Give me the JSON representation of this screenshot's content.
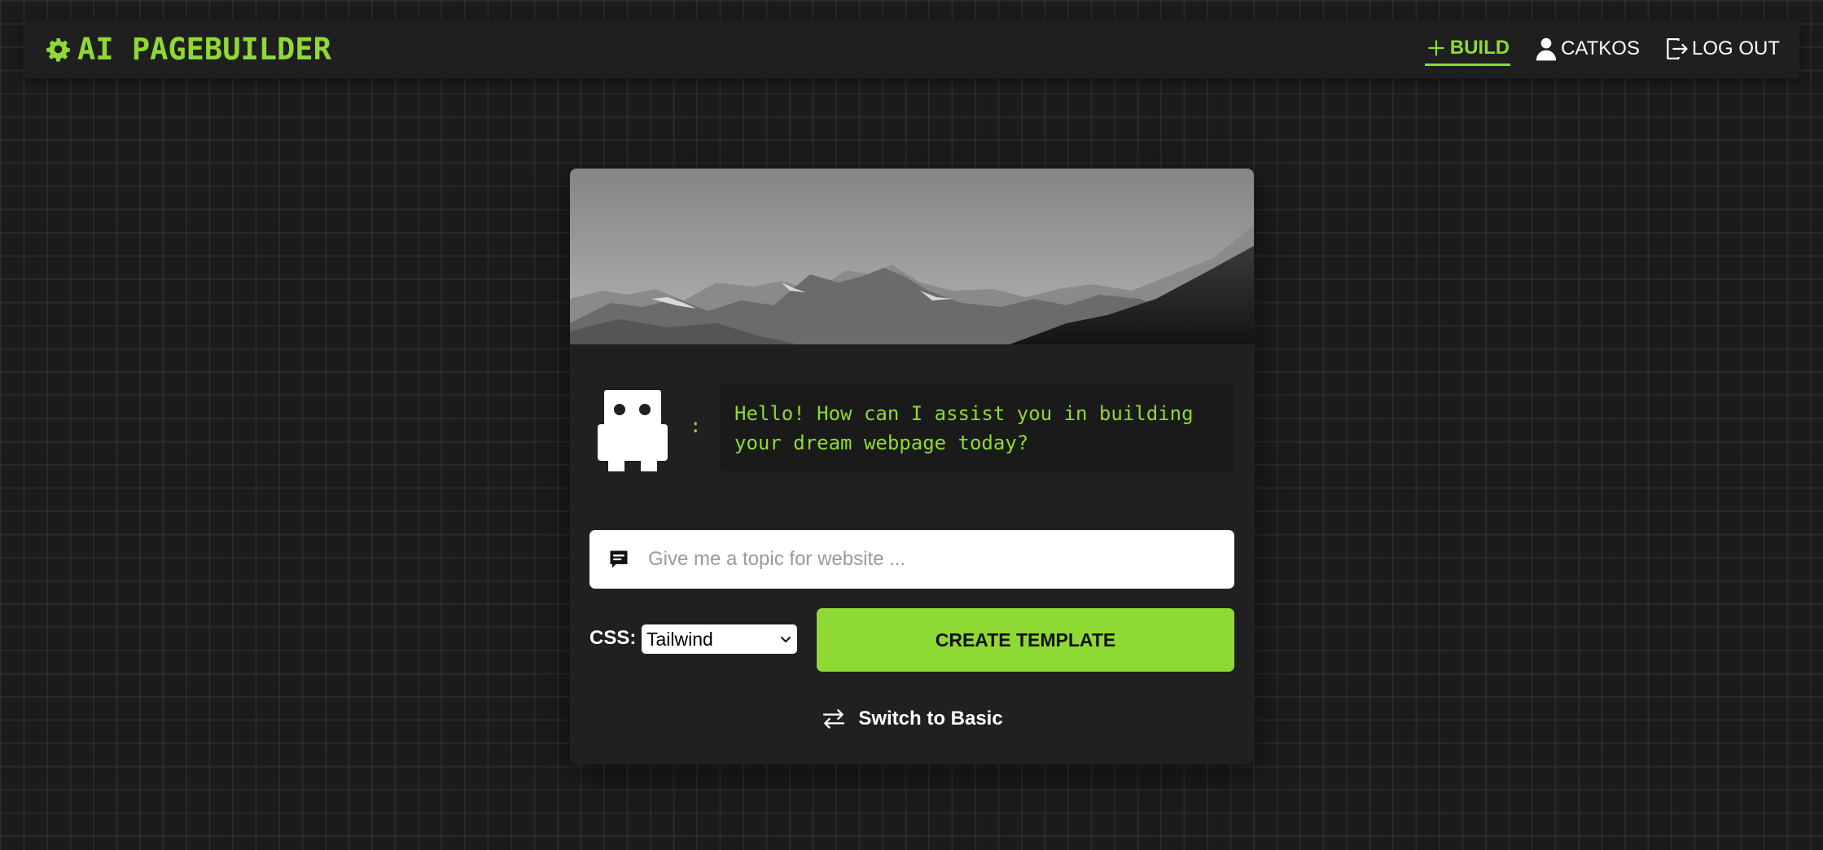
{
  "app": {
    "title": "AI PAGEBUILDER"
  },
  "nav": {
    "build_label": "BUILD",
    "user_label": "CATKOS",
    "logout_label": "LOG OUT"
  },
  "chat": {
    "separator": ":",
    "bot_message": "Hello! How can I assist you in building your dream webpage today?"
  },
  "topic_input": {
    "placeholder": "Give me a topic for website ...",
    "value": ""
  },
  "css_option": {
    "label": "CSS:",
    "selected": "Tailwind"
  },
  "actions": {
    "create_label": "CREATE TEMPLATE",
    "switch_label": "Switch to Basic"
  },
  "colors": {
    "accent": "#8fd935",
    "background": "#1b1b1b",
    "panel": "#202020",
    "bubble": "#1a1a1a"
  },
  "icons": {
    "brand": "gear-icon",
    "build": "plus-icon",
    "user": "user-icon",
    "logout": "logout-icon",
    "input": "chat-bubble-icon",
    "select": "chevron-down-icon",
    "switch": "swap-arrows-icon",
    "avatar": "robot-icon"
  }
}
